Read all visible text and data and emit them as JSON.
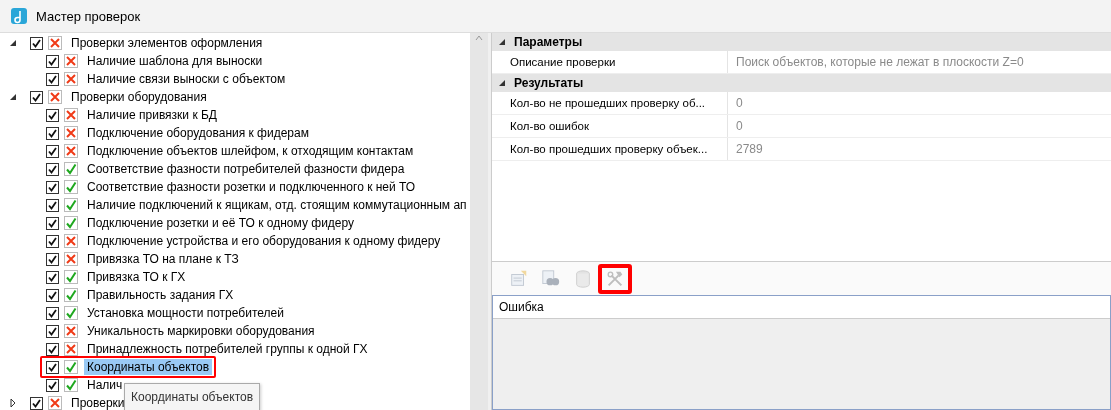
{
  "window": {
    "title": "Мастер проверок"
  },
  "tree": [
    {
      "label": "Проверки элементов оформления",
      "checked": true,
      "passed": false,
      "expanded": true,
      "children": [
        {
          "label": "Наличие шаблона для выноски",
          "checked": true,
          "passed": false,
          "selected": false
        },
        {
          "label": "Наличие связи выноски с объектом",
          "checked": true,
          "passed": false,
          "selected": false
        }
      ]
    },
    {
      "label": "Проверки оборудования",
      "checked": true,
      "passed": false,
      "expanded": true,
      "children": [
        {
          "label": "Наличие привязки к БД",
          "checked": true,
          "passed": false,
          "selected": false
        },
        {
          "label": "Подключение оборудования к фидерам",
          "checked": true,
          "passed": false,
          "selected": false
        },
        {
          "label": "Подключение объектов шлейфом, к отходящим контактам",
          "checked": true,
          "passed": false,
          "selected": false
        },
        {
          "label": "Соответствие фазности потребителей фазности фидера",
          "checked": true,
          "passed": true,
          "selected": false
        },
        {
          "label": "Соответствие фазности розетки и подключенного к ней ТО",
          "checked": true,
          "passed": true,
          "selected": false
        },
        {
          "label": "Наличие подключений к ящикам, отд. стоящим коммутационным ап",
          "checked": true,
          "passed": true,
          "selected": false
        },
        {
          "label": "Подключение розетки и её ТО к одному фидеру",
          "checked": true,
          "passed": true,
          "selected": false
        },
        {
          "label": "Подключение устройства и его оборудования к одному фидеру",
          "checked": true,
          "passed": false,
          "selected": false
        },
        {
          "label": "Привязка ТО на плане к ТЗ",
          "checked": true,
          "passed": false,
          "selected": false
        },
        {
          "label": "Привязка ТО к ГХ",
          "checked": true,
          "passed": true,
          "selected": false
        },
        {
          "label": "Правильность задания ГХ",
          "checked": true,
          "passed": true,
          "selected": false
        },
        {
          "label": "Установка мощности потребителей",
          "checked": true,
          "passed": true,
          "selected": false
        },
        {
          "label": "Уникальность маркировки оборудования",
          "checked": true,
          "passed": false,
          "selected": false
        },
        {
          "label": "Принадлежность потребителей группы к одной ГХ",
          "checked": true,
          "passed": false,
          "selected": false
        },
        {
          "label": "Координаты объектов",
          "checked": true,
          "passed": true,
          "selected": true,
          "highlighted": true
        },
        {
          "label": "Налич",
          "checked": true,
          "passed": true,
          "selected": false
        }
      ]
    },
    {
      "label": "Проверки",
      "checked": true,
      "passed": false,
      "expanded": false
    }
  ],
  "tooltip": "Координаты объектов",
  "properties": [
    {
      "title": "Параметры",
      "expanded": true,
      "rows": [
        {
          "name": "Описание проверки",
          "value": "Поиск объектов, которые не лежат в плоскости Z=0"
        }
      ]
    },
    {
      "title": "Результаты",
      "expanded": true,
      "rows": [
        {
          "name": "Кол-во не прошедших проверку об...",
          "value": "0"
        },
        {
          "name": "Кол-во ошибок",
          "value": "0"
        },
        {
          "name": "Кол-во прошедших проверку объек...",
          "value": "2789"
        }
      ]
    }
  ],
  "toolbar": [
    {
      "kind": "properties",
      "disabled": true
    },
    {
      "kind": "binoculars",
      "disabled": true
    },
    {
      "kind": "database",
      "disabled": true
    },
    {
      "kind": "tools",
      "disabled": true,
      "highlighted": true
    }
  ],
  "errors_table": {
    "columns": [
      "Ошибка"
    ]
  }
}
